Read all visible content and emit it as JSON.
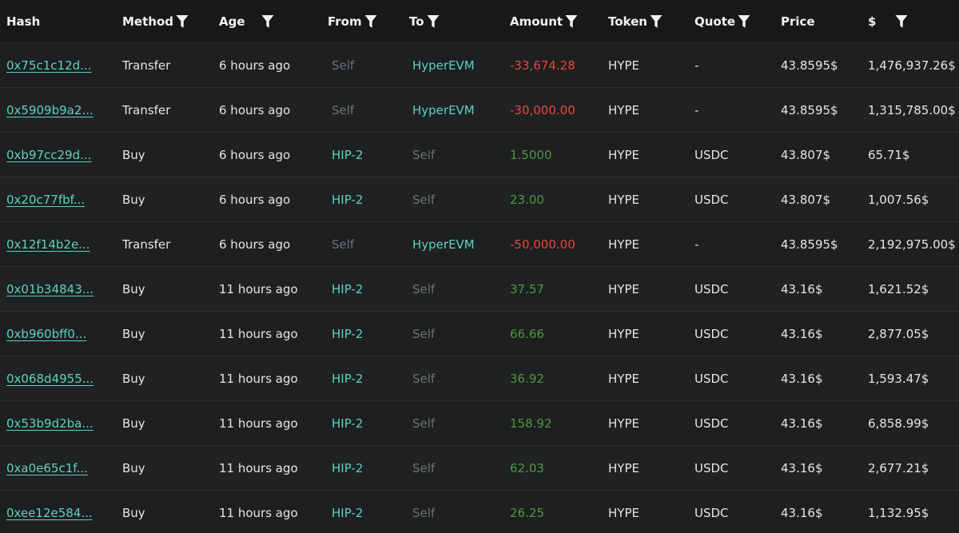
{
  "colors": {
    "accent": "#5fd3b8",
    "negative": "#e5483a",
    "positive": "#4c9a3c",
    "muted": "#6e7375"
  },
  "columns": [
    {
      "key": "hash",
      "label": "Hash",
      "filter": false
    },
    {
      "key": "method",
      "label": "Method",
      "filter": true
    },
    {
      "key": "age",
      "label": "Age",
      "filter": true
    },
    {
      "key": "from",
      "label": "From",
      "filter": true
    },
    {
      "key": "to",
      "label": "To",
      "filter": true
    },
    {
      "key": "amount",
      "label": "Amount",
      "filter": true
    },
    {
      "key": "token",
      "label": "Token",
      "filter": true
    },
    {
      "key": "quote",
      "label": "Quote",
      "filter": true
    },
    {
      "key": "price",
      "label": "Price",
      "filter": false
    },
    {
      "key": "usd",
      "label": "$",
      "filter": true
    }
  ],
  "rows": [
    {
      "hash": "0x75c1c12d...",
      "method": "Transfer",
      "age": "6 hours ago",
      "from": "Self",
      "to": "HyperEVM",
      "amount": "-33,674.28",
      "direction": "neg",
      "token": "HYPE",
      "quote": "-",
      "price": "43.8595$",
      "usd": "1,476,937.26$"
    },
    {
      "hash": "0x5909b9a2...",
      "method": "Transfer",
      "age": "6 hours ago",
      "from": "Self",
      "to": "HyperEVM",
      "amount": "-30,000.00",
      "direction": "neg",
      "token": "HYPE",
      "quote": "-",
      "price": "43.8595$",
      "usd": "1,315,785.00$"
    },
    {
      "hash": "0xb97cc29d...",
      "method": "Buy",
      "age": "6 hours ago",
      "from": "HIP-2",
      "to": "Self",
      "amount": "1.5000",
      "direction": "pos",
      "token": "HYPE",
      "quote": "USDC",
      "price": "43.807$",
      "usd": "65.71$"
    },
    {
      "hash": "0x20c77fbf...",
      "method": "Buy",
      "age": "6 hours ago",
      "from": "HIP-2",
      "to": "Self",
      "amount": "23.00",
      "direction": "pos",
      "token": "HYPE",
      "quote": "USDC",
      "price": "43.807$",
      "usd": "1,007.56$"
    },
    {
      "hash": "0x12f14b2e...",
      "method": "Transfer",
      "age": "6 hours ago",
      "from": "Self",
      "to": "HyperEVM",
      "amount": "-50,000.00",
      "direction": "neg",
      "token": "HYPE",
      "quote": "-",
      "price": "43.8595$",
      "usd": "2,192,975.00$"
    },
    {
      "hash": "0x01b34843...",
      "method": "Buy",
      "age": "11 hours ago",
      "from": "HIP-2",
      "to": "Self",
      "amount": "37.57",
      "direction": "pos",
      "token": "HYPE",
      "quote": "USDC",
      "price": "43.16$",
      "usd": "1,621.52$"
    },
    {
      "hash": "0xb960bff0...",
      "method": "Buy",
      "age": "11 hours ago",
      "from": "HIP-2",
      "to": "Self",
      "amount": "66.66",
      "direction": "pos",
      "token": "HYPE",
      "quote": "USDC",
      "price": "43.16$",
      "usd": "2,877.05$"
    },
    {
      "hash": "0x068d4955...",
      "method": "Buy",
      "age": "11 hours ago",
      "from": "HIP-2",
      "to": "Self",
      "amount": "36.92",
      "direction": "pos",
      "token": "HYPE",
      "quote": "USDC",
      "price": "43.16$",
      "usd": "1,593.47$"
    },
    {
      "hash": "0x53b9d2ba...",
      "method": "Buy",
      "age": "11 hours ago",
      "from": "HIP-2",
      "to": "Self",
      "amount": "158.92",
      "direction": "pos",
      "token": "HYPE",
      "quote": "USDC",
      "price": "43.16$",
      "usd": "6,858.99$"
    },
    {
      "hash": "0xa0e65c1f...",
      "method": "Buy",
      "age": "11 hours ago",
      "from": "HIP-2",
      "to": "Self",
      "amount": "62.03",
      "direction": "pos",
      "token": "HYPE",
      "quote": "USDC",
      "price": "43.16$",
      "usd": "2,677.21$"
    },
    {
      "hash": "0xee12e584...",
      "method": "Buy",
      "age": "11 hours ago",
      "from": "HIP-2",
      "to": "Self",
      "amount": "26.25",
      "direction": "pos",
      "token": "HYPE",
      "quote": "USDC",
      "price": "43.16$",
      "usd": "1,132.95$"
    }
  ]
}
